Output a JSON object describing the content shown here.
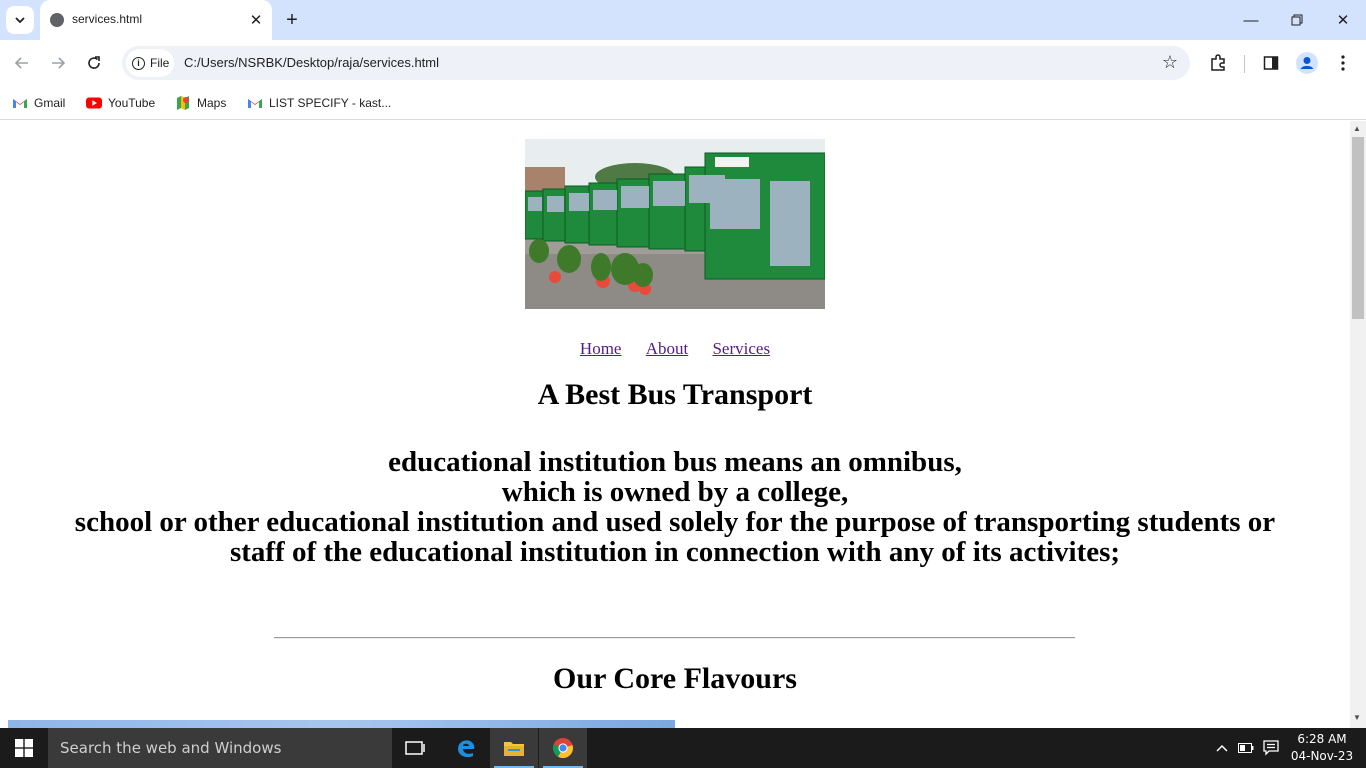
{
  "browser": {
    "tab_title": "services.html",
    "url_chip": "File",
    "url": "C:/Users/NSRBK/Desktop/raja/services.html",
    "bookmarks": [
      {
        "label": "Gmail",
        "icon": "gmail-icon"
      },
      {
        "label": "YouTube",
        "icon": "youtube-icon"
      },
      {
        "label": "Maps",
        "icon": "maps-icon"
      },
      {
        "label": "LIST SPECIFY - kast...",
        "icon": "gmail-icon"
      }
    ]
  },
  "page": {
    "nav": [
      "Home",
      "About",
      "Services"
    ],
    "heading": "A Best Bus Transport",
    "description_lines": [
      "educational institution bus means an omnibus,",
      "which is owned by a college,",
      "school or other educational institution and used solely for the purpose of transporting students or",
      "staff of the educational institution in connection with any of its activites;"
    ],
    "section_heading": "Our Core Flavours"
  },
  "taskbar": {
    "search_placeholder": "Search the web and Windows",
    "time": "6:28 AM",
    "date": "04-Nov-23"
  },
  "colors": {
    "tabstrip": "#d3e3fd",
    "link_visited": "#551a8b",
    "taskbar": "#1b1b1b"
  }
}
